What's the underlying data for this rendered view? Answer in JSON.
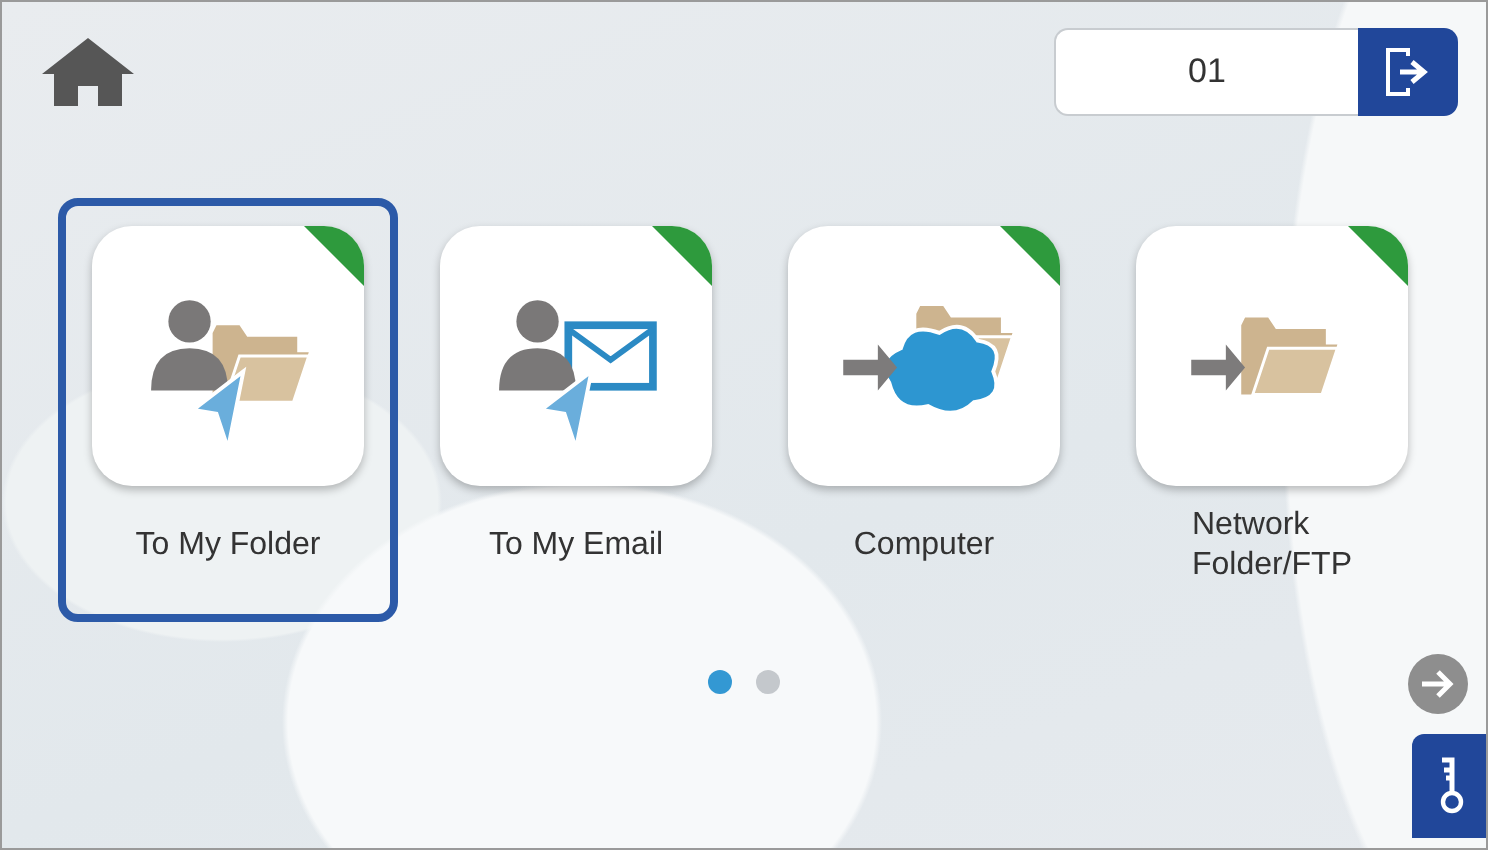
{
  "user_field": {
    "value": "01"
  },
  "tiles": [
    {
      "kind": "my_folder",
      "label": "To My Folder",
      "selected": true
    },
    {
      "kind": "my_email",
      "label": "To My Email",
      "selected": false
    },
    {
      "kind": "computer",
      "label": "Computer",
      "selected": false
    },
    {
      "kind": "network",
      "label": "Network\nFolder/FTP",
      "selected": false
    }
  ],
  "pages": [
    {
      "selected": true
    },
    {
      "selected": false
    }
  ]
}
